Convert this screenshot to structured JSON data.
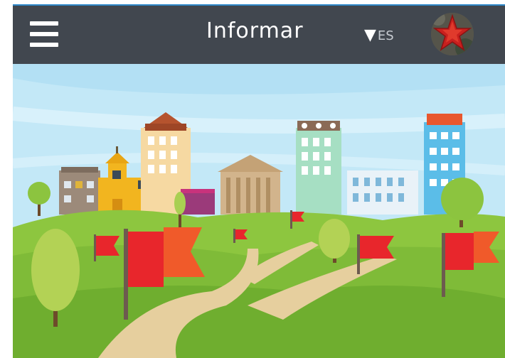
{
  "header": {
    "title": "Informar",
    "language": "ES",
    "menu_icon": "hamburger-menu-icon",
    "language_icon": "triangle-down-icon",
    "avatar_icon": "starfish-avatar"
  },
  "colors": {
    "header_bg": "#41474f",
    "header_accent": "#2e88c9",
    "sky": "#bfe6f6",
    "grass": "#7dbb3b",
    "flag": "#e8262c",
    "path": "#e6cf9e"
  }
}
